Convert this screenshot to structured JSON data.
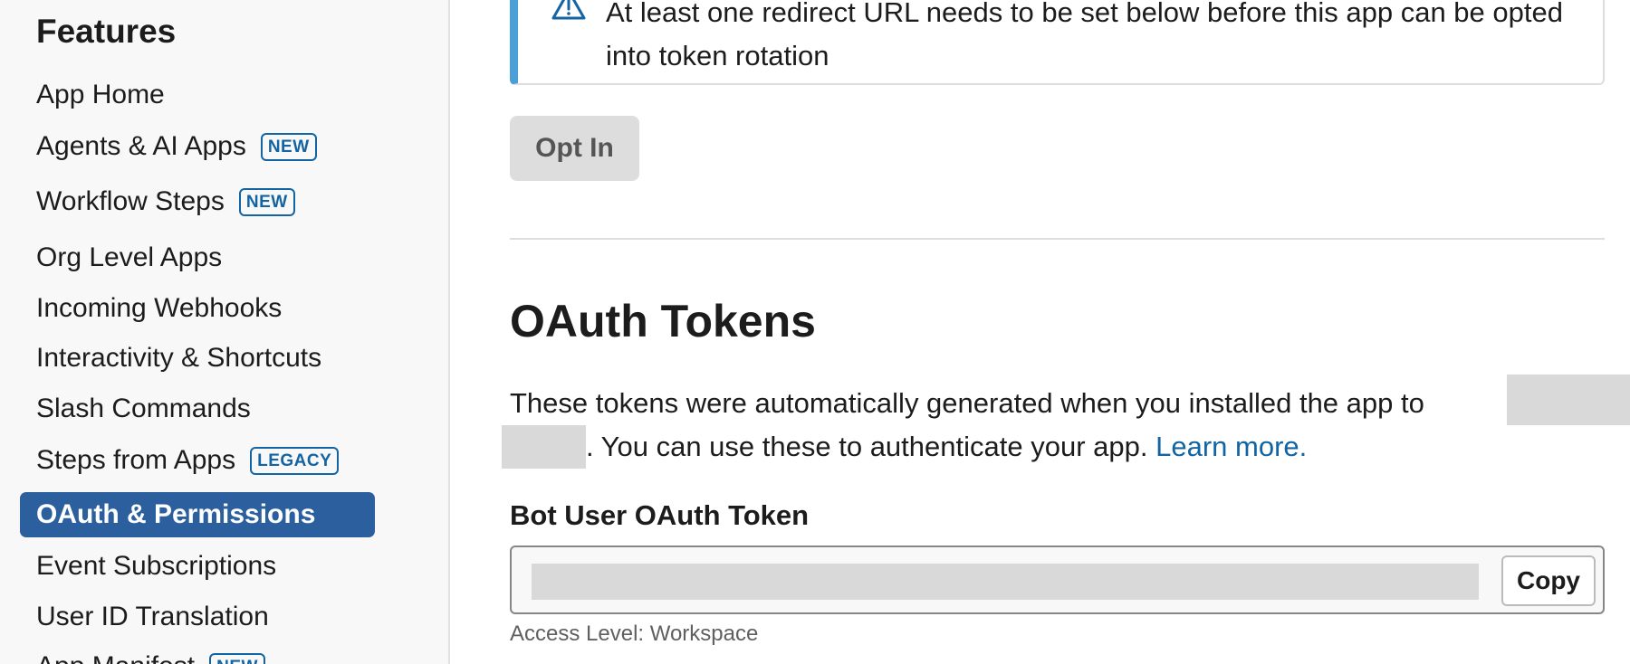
{
  "sidebar": {
    "heading": "Features",
    "items": [
      {
        "label": "App Home",
        "badge": ""
      },
      {
        "label": "Agents & AI Apps",
        "badge": "NEW"
      },
      {
        "label": "Workflow Steps",
        "badge": "NEW"
      },
      {
        "label": "Org Level Apps",
        "badge": ""
      },
      {
        "label": "Incoming Webhooks",
        "badge": ""
      },
      {
        "label": "Interactivity & Shortcuts",
        "badge": ""
      },
      {
        "label": "Slash Commands",
        "badge": ""
      },
      {
        "label": "Steps from Apps",
        "badge": "LEGACY"
      },
      {
        "label": "OAuth & Permissions",
        "badge": "",
        "active": true
      },
      {
        "label": "Event Subscriptions",
        "badge": ""
      },
      {
        "label": "User ID Translation",
        "badge": ""
      },
      {
        "label": "App Manifest",
        "badge": "NEW"
      }
    ]
  },
  "alert": {
    "text": "At least one redirect URL needs to be set below before this app can be opted into token rotation",
    "icon": "warning-icon"
  },
  "opt_in": {
    "label": "Opt In"
  },
  "oauth": {
    "title": "OAuth Tokens",
    "description_part1": "These tokens were automatically generated when you installed the app to",
    "description_part2": ". You can use these to authenticate your app.",
    "link_text": "Learn more."
  },
  "bot_token": {
    "label": "Bot User OAuth Token",
    "copy_label": "Copy",
    "access_level": "Access Level: Workspace"
  },
  "colors": {
    "accent": "#1264a3",
    "active_nav": "#2c5f9e",
    "alert_bar": "#4a9fd8"
  }
}
